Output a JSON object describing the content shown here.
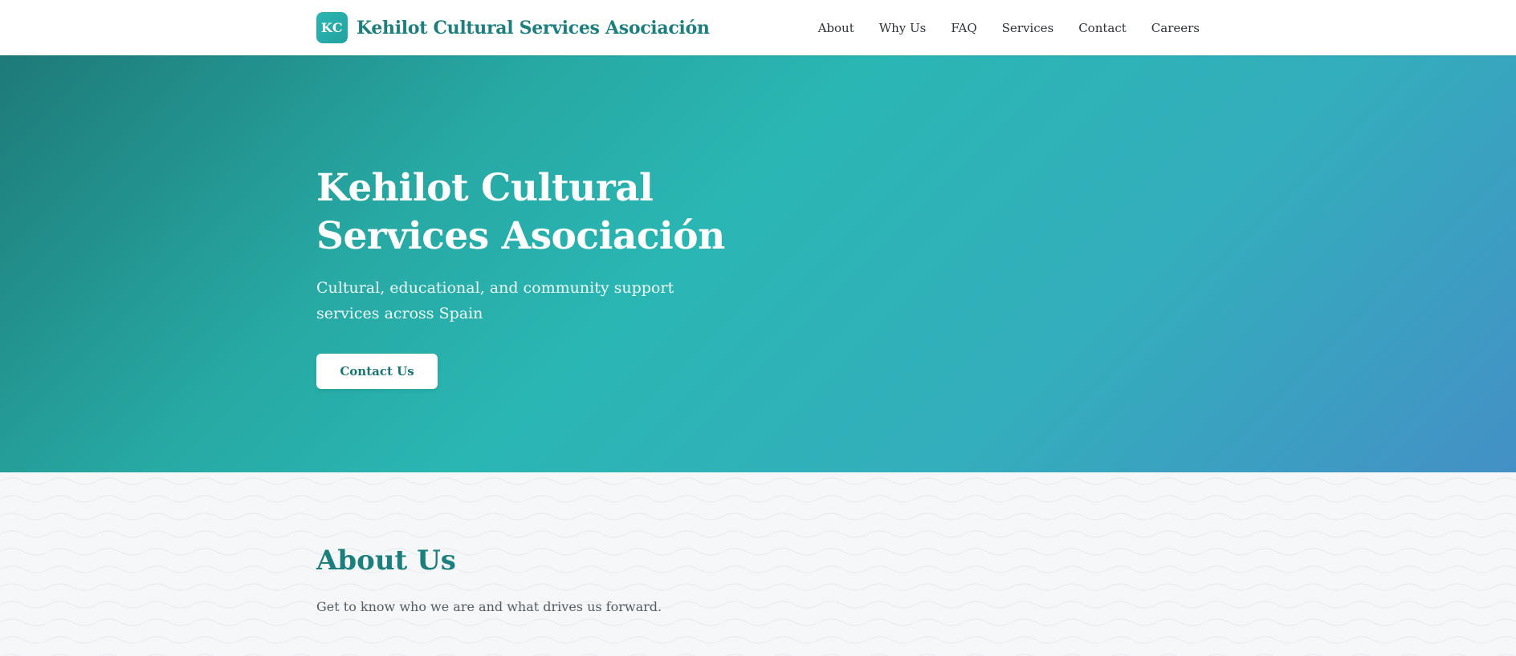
{
  "header": {
    "logo_initials": "KC",
    "brand_name": "Kehilot Cultural Services Asociación",
    "nav": [
      {
        "label": "About"
      },
      {
        "label": "Why Us"
      },
      {
        "label": "FAQ"
      },
      {
        "label": "Services"
      },
      {
        "label": "Contact"
      },
      {
        "label": "Careers"
      }
    ]
  },
  "hero": {
    "title": "Kehilot Cultural Services Asociación",
    "subtitle": "Cultural, educational, and community support services across Spain",
    "cta_label": "Contact Us"
  },
  "about": {
    "title": "About Us",
    "text": "Get to know who we are and what drives us forward."
  },
  "colors": {
    "accent": "#1d7f7d",
    "brand_teal": "#2ab6b3",
    "gradient_end": "#4490c6",
    "section_bg": "#f6f7f9"
  }
}
